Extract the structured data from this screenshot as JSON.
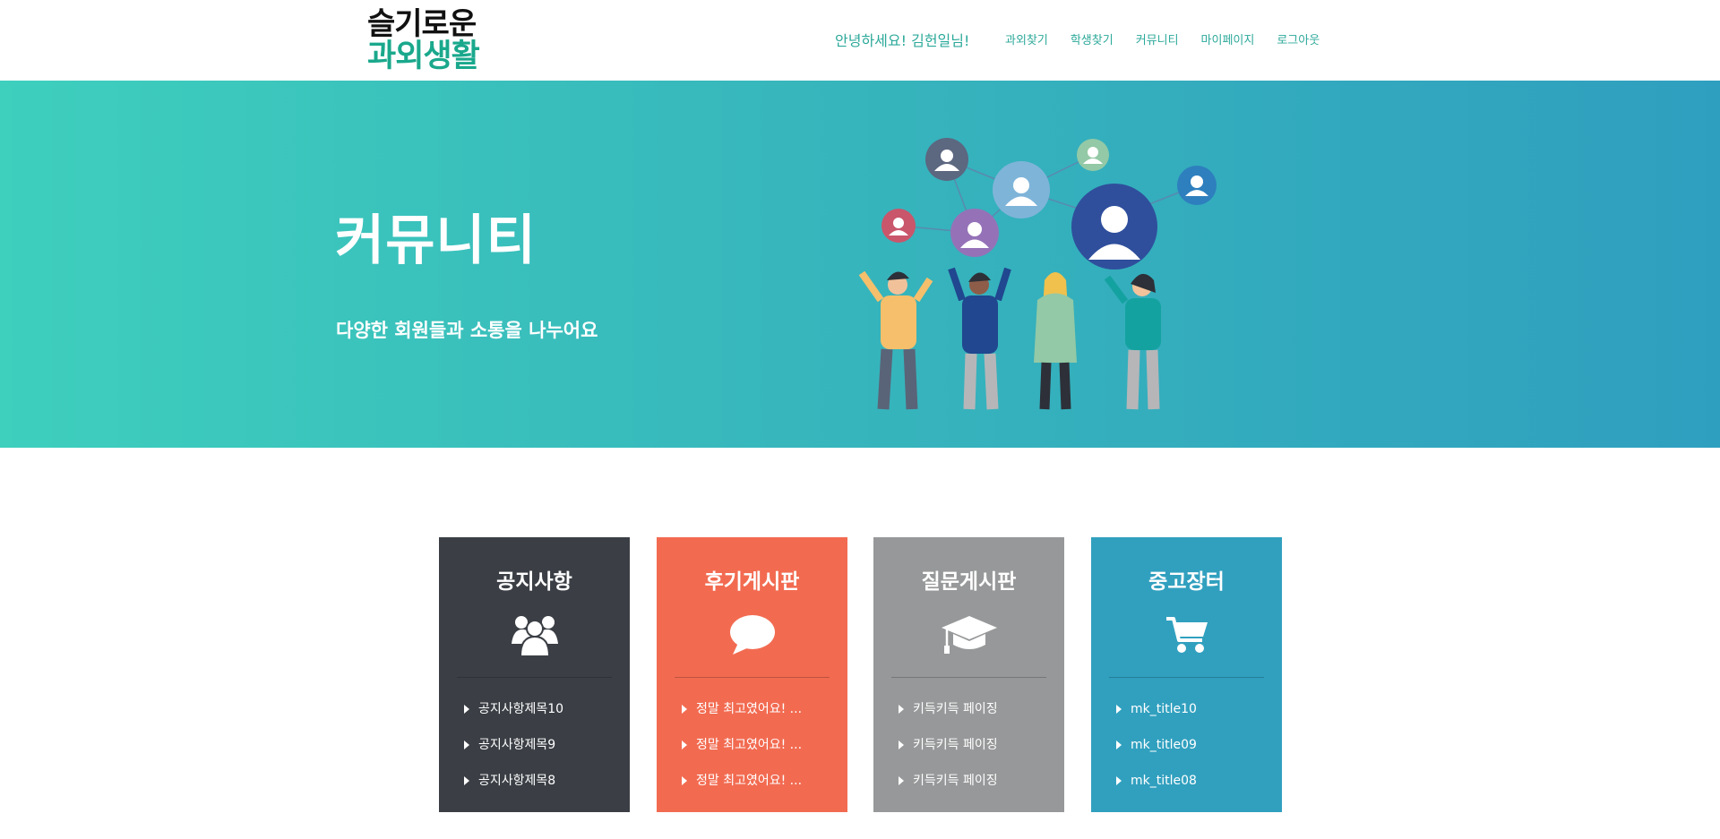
{
  "logo": {
    "line1": "슬기로운",
    "line2": "과외생활"
  },
  "header": {
    "greeting": "안녕하세요! 김헌일님!",
    "nav": [
      "과외찾기",
      "학생찾기",
      "커뮤니티",
      "마이페이지",
      "로그아웃"
    ]
  },
  "hero": {
    "title": "커뮤니티",
    "subtitle": "다양한 회원들과 소통을 나누어요"
  },
  "cards": [
    {
      "title": "공지사항",
      "icon": "users-icon",
      "color": "#3b3f45",
      "items": [
        "공지사항제목10",
        "공지사항제목9",
        "공지사항제목8"
      ]
    },
    {
      "title": "후기게시판",
      "icon": "speech-bubble-icon",
      "color": "#f26b51",
      "items": [
        "정말 최고였어요! ...",
        "정말 최고였어요! ...",
        "정말 최고였어요! ..."
      ]
    },
    {
      "title": "질문게시판",
      "icon": "graduation-cap-icon",
      "color": "#979899",
      "items": [
        "키득키득 페이징",
        "키득키득 페이징",
        "키득키득 페이징"
      ]
    },
    {
      "title": "중고장터",
      "icon": "shopping-cart-icon",
      "color": "#31a0bf",
      "items": [
        "mk_title10",
        "mk_title09",
        "mk_title08"
      ]
    }
  ]
}
